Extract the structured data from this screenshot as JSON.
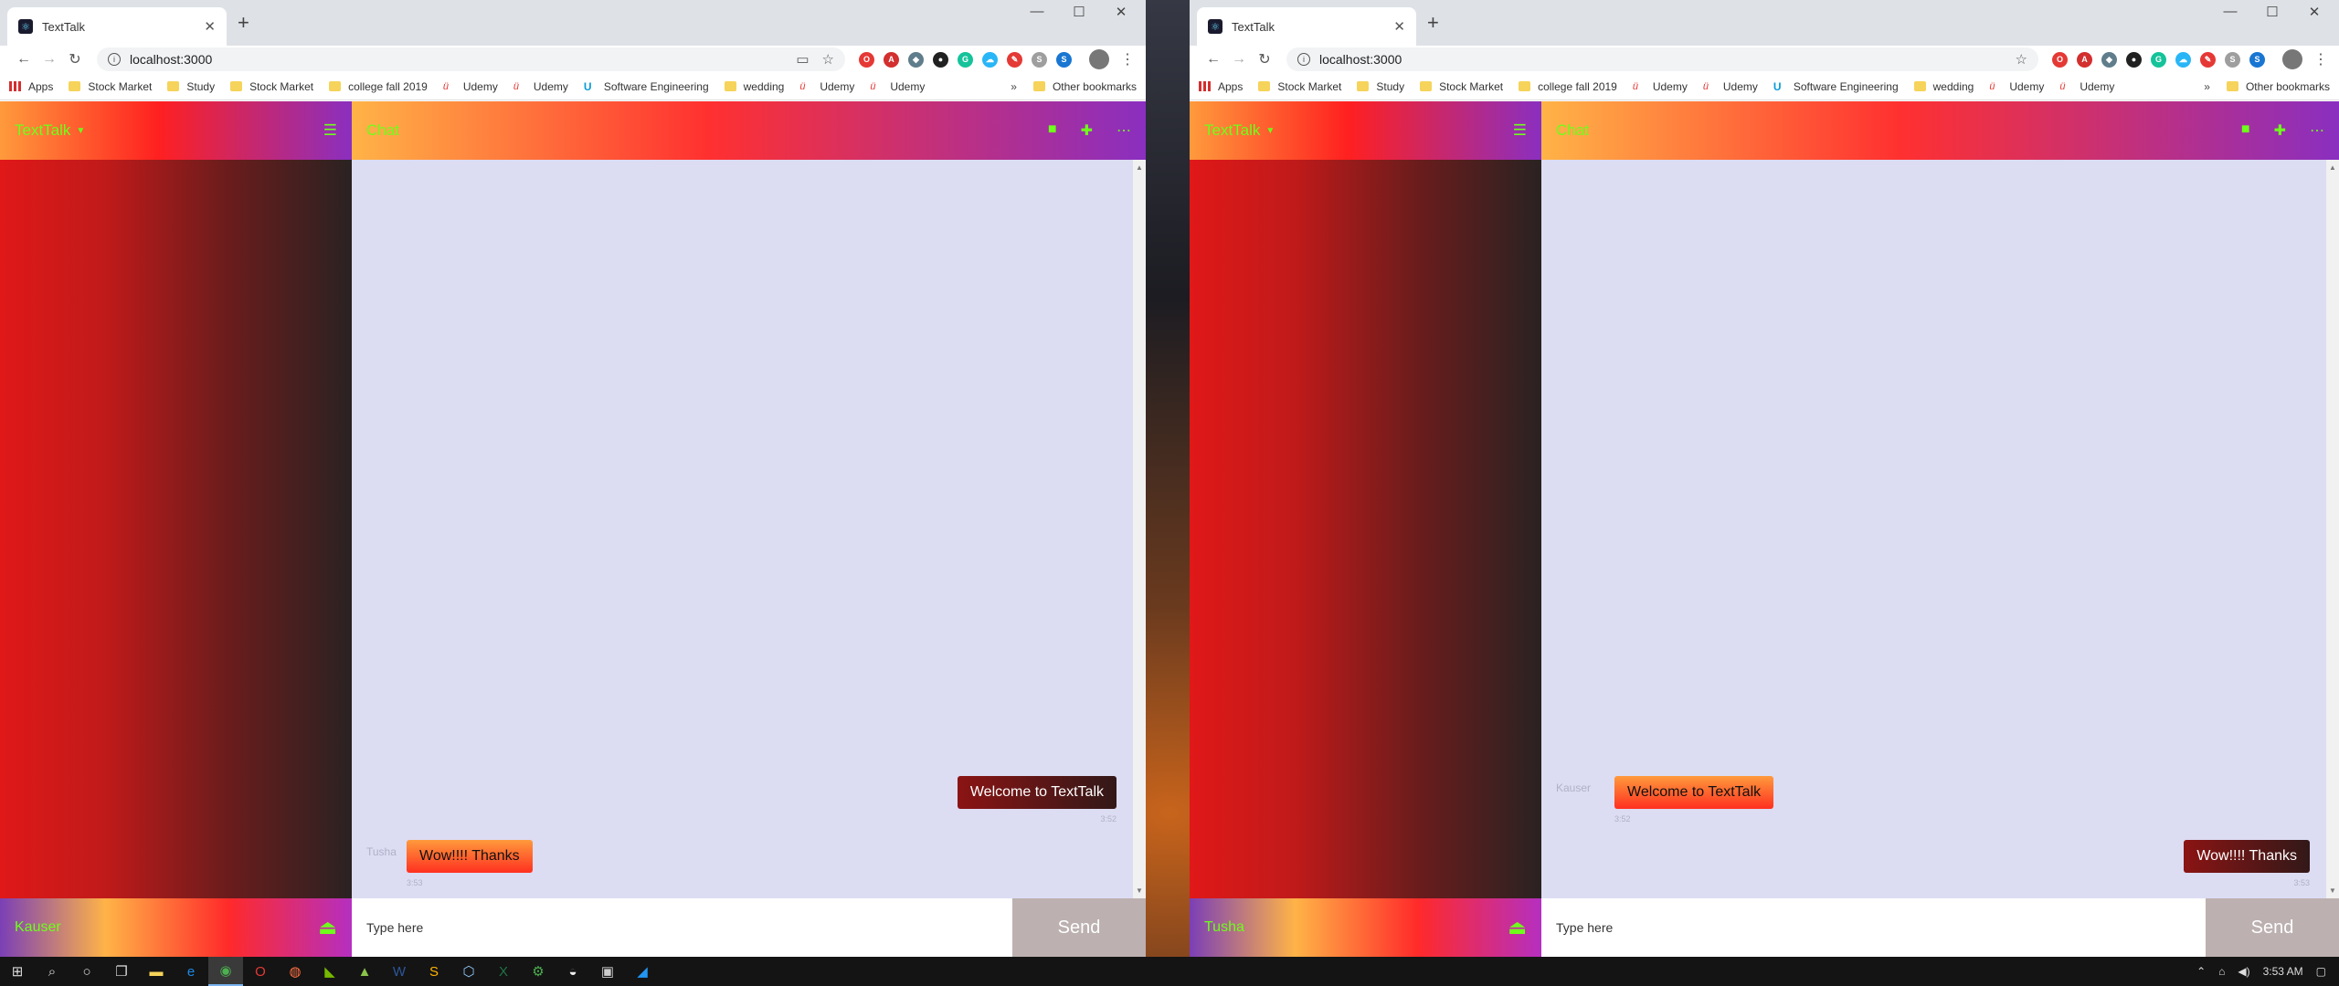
{
  "browser_left": {
    "tab_title": "TextTalk",
    "address": "localhost:3000",
    "bookmarks": [
      "Apps",
      "Stock Market",
      "Study",
      "Stock Market",
      "college fall 2019",
      "Udemy",
      "Udemy",
      "Software Engineering",
      "wedding",
      "Udemy",
      "Udemy"
    ],
    "bookmark_more": "»",
    "other_bookmarks": "Other bookmarks"
  },
  "browser_right": {
    "tab_title": "TextTalk",
    "address": "localhost:3000",
    "bookmarks": [
      "Apps",
      "Stock Market",
      "Study",
      "Stock Market",
      "college fall 2019",
      "Udemy",
      "Udemy",
      "Software Engineering",
      "wedding",
      "Udemy",
      "Udemy"
    ],
    "bookmark_more": "»",
    "other_bookmarks": "Other bookmarks"
  },
  "app_left": {
    "brand": "TextTalk",
    "chat_title": "Chat",
    "current_user": "Kauser",
    "composer_placeholder": "Type here",
    "send_label": "Send",
    "messages": [
      {
        "text": "Welcome to TextTalk",
        "time": "3:52"
      },
      {
        "sender": "Tusha",
        "text": "Wow!!!! Thanks",
        "time": "3:53"
      }
    ]
  },
  "app_right": {
    "brand": "TextTalk",
    "chat_title": "Chat",
    "current_user": "Tusha",
    "composer_placeholder": "Type here",
    "send_label": "Send",
    "messages": [
      {
        "sender": "Kauser",
        "text": "Welcome to TextTalk",
        "time": "3:52"
      },
      {
        "text": "Wow!!!! Thanks",
        "time": "3:53"
      }
    ]
  },
  "taskbar": {
    "clock": "3:53 AM"
  },
  "colors": {
    "accent_green": "#6eff1a",
    "chat_background": "#dcdcf3",
    "send_button": "#bcb0b0"
  }
}
